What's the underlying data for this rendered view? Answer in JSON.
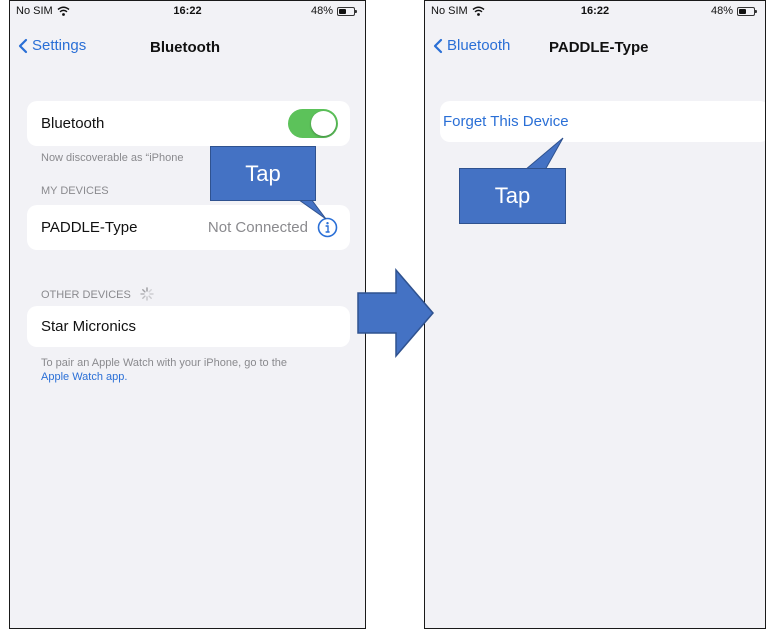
{
  "left_screen": {
    "status": {
      "carrier": "No SIM",
      "time": "16:22",
      "battery": "48%"
    },
    "nav": {
      "back_label": "Settings",
      "title": "Bluetooth"
    },
    "bluetooth_row": {
      "label": "Bluetooth",
      "enabled": true
    },
    "discoverable_text": "Now discoverable as “iPhone",
    "my_devices_header": "MY DEVICES",
    "device": {
      "name": "PADDLE-Type",
      "status": "Not Connected"
    },
    "other_devices_header": "OTHER DEVICES",
    "other_device": {
      "name": "Star Micronics"
    },
    "watch_note": "To pair an Apple Watch with your iPhone, go to the",
    "watch_link": "Apple Watch app."
  },
  "right_screen": {
    "status": {
      "carrier": "No SIM",
      "time": "16:22",
      "battery": "48%"
    },
    "nav": {
      "back_label": "Bluetooth",
      "title": "PADDLE-Type"
    },
    "forget_button": "Forget This Device"
  },
  "callouts": {
    "left_label": "Tap",
    "right_label": "Tap"
  },
  "colors": {
    "accent": "#2a6fd6",
    "toggle_on": "#5cc25a",
    "callout_fill": "#4472c4",
    "arrow_fill": "#4472c4"
  },
  "icons": [
    "wifi-icon",
    "battery-icon",
    "chevron-left-icon",
    "info-icon",
    "spinner-icon",
    "arrow-right-icon"
  ]
}
